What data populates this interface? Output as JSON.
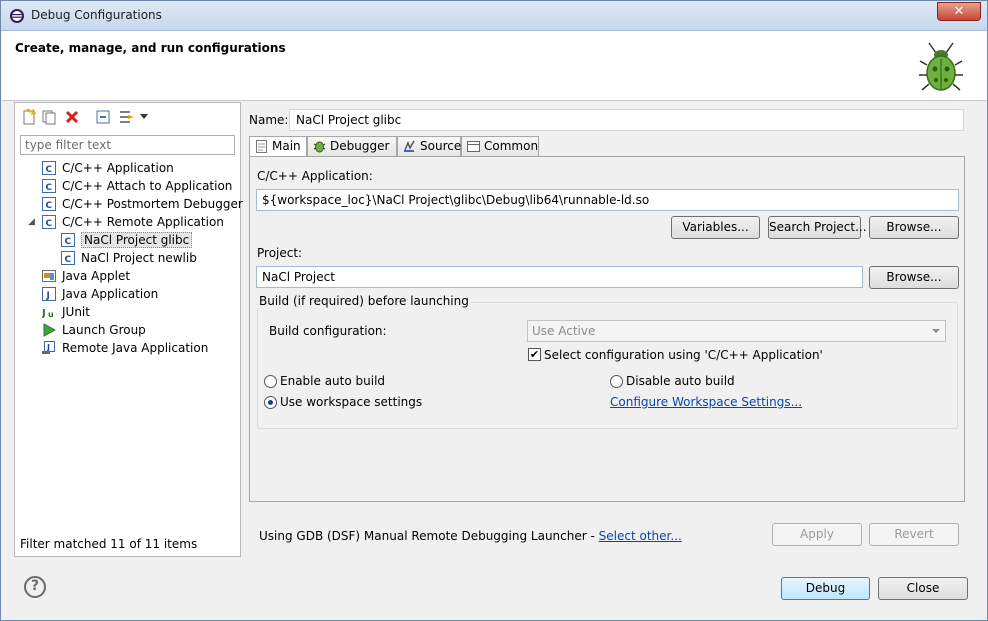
{
  "window": {
    "title": "Debug Configurations",
    "close_glyph": "✕"
  },
  "header": {
    "title": "Create, manage, and run configurations",
    "bug_icon": "bug-icon"
  },
  "left": {
    "filter_placeholder": "type filter text",
    "toolbar_icons": [
      "new-config-icon",
      "duplicate-icon",
      "delete-icon",
      "collapse-all-icon",
      "filter-icon",
      "dropdown-arrow-icon"
    ],
    "tree": [
      {
        "label": "C/C++ Application",
        "icon": "c-config-icon"
      },
      {
        "label": "C/C++ Attach to Application",
        "icon": "c-config-icon"
      },
      {
        "label": "C/C++ Postmortem Debugger",
        "icon": "c-config-icon"
      },
      {
        "label": "C/C++ Remote Application",
        "icon": "c-config-icon",
        "expanded": true
      },
      {
        "label": "NaCl Project glibc",
        "icon": "c-config-icon",
        "selected": true,
        "child": true
      },
      {
        "label": "NaCl Project newlib",
        "icon": "c-config-icon",
        "child": true
      },
      {
        "label": "Java Applet",
        "icon": "java-applet-icon"
      },
      {
        "label": "Java Application",
        "icon": "java-app-icon"
      },
      {
        "label": "JUnit",
        "icon": "junit-icon"
      },
      {
        "label": "Launch Group",
        "icon": "launch-group-icon"
      },
      {
        "label": "Remote Java Application",
        "icon": "remote-java-icon"
      }
    ],
    "footer": "Filter matched 11 of 11 items"
  },
  "right": {
    "name_label": "Name:",
    "name_value": "NaCl Project glibc",
    "tabs": [
      {
        "label": "Main",
        "icon": "main-tab-icon",
        "active": true
      },
      {
        "label": "Debugger",
        "icon": "debugger-tab-icon"
      },
      {
        "label": "Source",
        "icon": "source-tab-icon"
      },
      {
        "label": "Common",
        "icon": "common-tab-icon"
      }
    ],
    "main": {
      "app_label": "C/C++ Application:",
      "app_value": "${workspace_loc}\\NaCl Project\\glibc\\Debug\\lib64\\runnable-ld.so",
      "variables_btn": "Variables...",
      "search_btn": "Search Project...",
      "browse_btn": "Browse...",
      "project_label": "Project:",
      "project_value": "NaCl Project",
      "project_browse_btn": "Browse...",
      "build_group_title": "Build (if required) before launching",
      "build_config_label": "Build configuration:",
      "build_config_value": "Use Active",
      "select_config_label": "Select configuration using 'C/C++ Application'",
      "select_config_checked": true,
      "enable_auto_build": "Enable auto build",
      "disable_auto_build": "Disable auto build",
      "use_workspace": "Use workspace settings",
      "configure_link": "Configure Workspace Settings..."
    },
    "launcher_text": "Using GDB (DSF) Manual Remote Debugging Launcher -",
    "select_other_link": "Select other...",
    "apply_btn": "Apply",
    "revert_btn": "Revert"
  },
  "footer": {
    "help_icon": "help-icon",
    "help_glyph": "?",
    "debug_btn": "Debug",
    "close_btn": "Close"
  },
  "colors": {
    "link": "#0645ad",
    "title_bar": "#c7d7ec",
    "default_button": "#bee6fd"
  }
}
